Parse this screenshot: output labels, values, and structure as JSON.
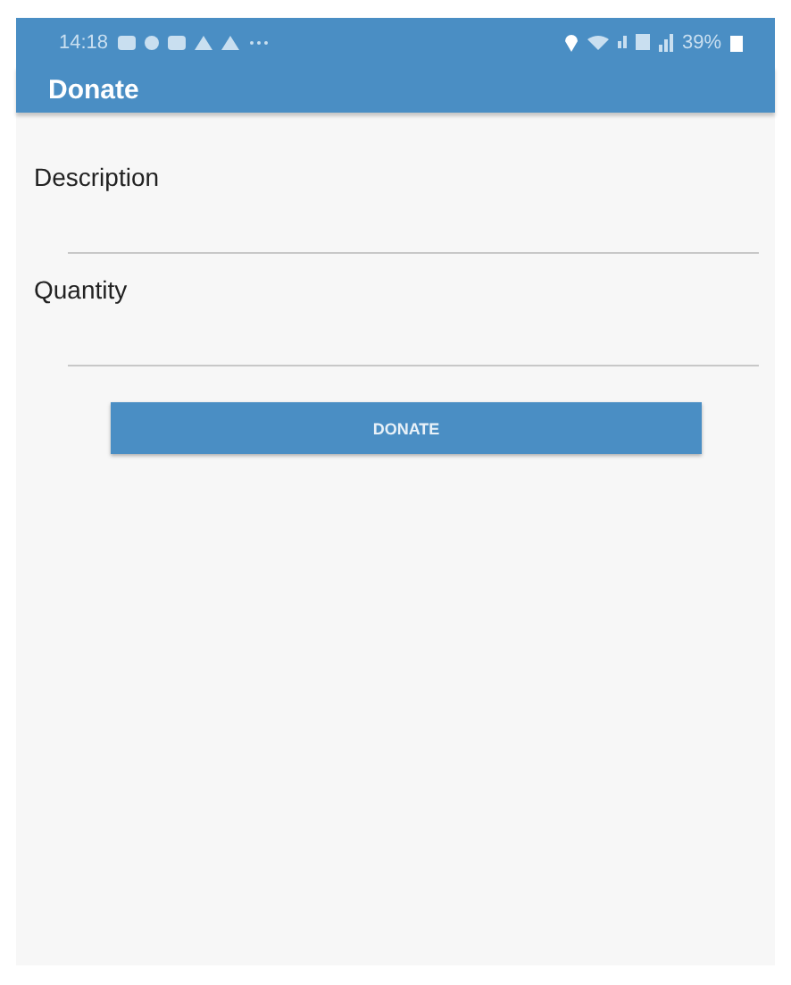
{
  "status_bar": {
    "time": "14:18",
    "battery": "39%"
  },
  "app_bar": {
    "title": "Donate"
  },
  "fields": [
    {
      "label": "Description"
    },
    {
      "label": "Quantity"
    }
  ],
  "button": {
    "label": "DONATE"
  }
}
